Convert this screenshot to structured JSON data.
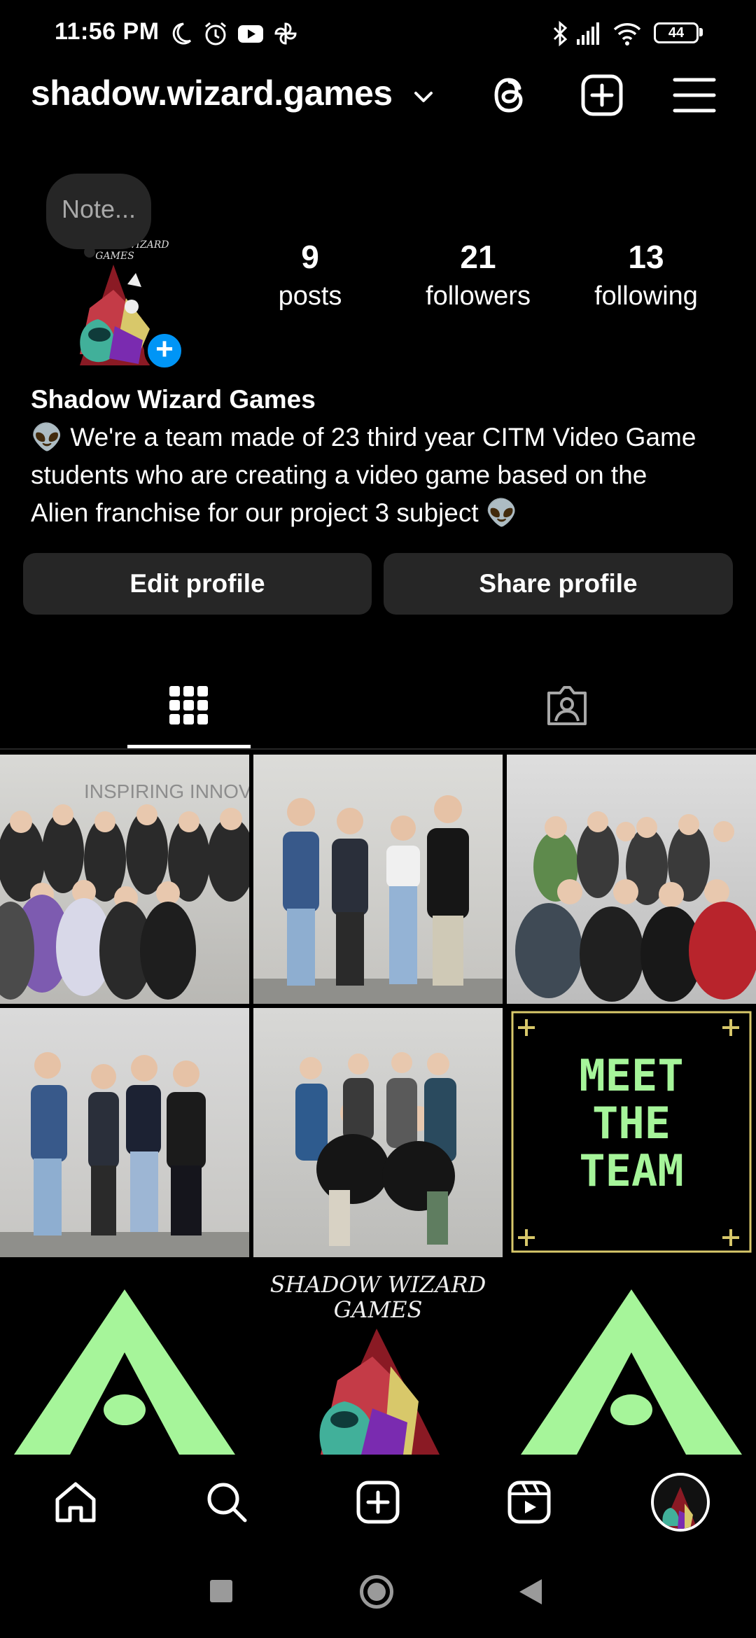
{
  "status_bar": {
    "time": "11:56 PM",
    "battery": "44",
    "icons": [
      "moon-icon",
      "alarm-icon",
      "youtube-icon",
      "pinwheel-icon",
      "bluetooth-icon",
      "signal-icon",
      "wifi-icon",
      "battery-icon"
    ]
  },
  "header": {
    "username": "shadow.wizard.games",
    "icons": [
      "chevron-down-icon",
      "threads-icon",
      "new-post-icon",
      "menu-icon"
    ]
  },
  "note": {
    "placeholder": "Note..."
  },
  "avatar": {
    "logo_text_line1": "SHADOW WIZARD",
    "logo_text_line2": "GAMES"
  },
  "stats": [
    {
      "value": "9",
      "label": "posts"
    },
    {
      "value": "21",
      "label": "followers"
    },
    {
      "value": "13",
      "label": "following"
    }
  ],
  "profile": {
    "name": "Shadow Wizard Games",
    "bio_line1": "👽 We're a team made of 23 third year CITM Video Game",
    "bio_line2": "students who are creating a video game based on the",
    "bio_line3": "Alien franchise for our project 3 subject 👽"
  },
  "buttons": {
    "edit": "Edit profile",
    "share": "Share profile"
  },
  "tabs": {
    "icons": [
      "grid-icon",
      "tagged-icon"
    ],
    "active": "grid"
  },
  "grid": {
    "tiles": [
      {
        "kind": "photo",
        "description_icon": "group-photo"
      },
      {
        "kind": "photo",
        "description_icon": "group-photo"
      },
      {
        "kind": "photo",
        "description_icon": "group-photo"
      },
      {
        "kind": "photo",
        "description_icon": "group-photo"
      },
      {
        "kind": "photo",
        "description_icon": "group-photo"
      },
      {
        "kind": "graphic",
        "line1": "MEET",
        "line2": "THE",
        "line3": "TEAM"
      },
      {
        "kind": "logo",
        "logo_line1": "SHADOW WIZARD",
        "logo_line2": "GAMES"
      },
      {
        "kind": "logo-triangle"
      },
      {
        "kind": "logo-triangle"
      }
    ],
    "photo_backdrop_text": "INSPIRING INNOVAT"
  },
  "bottom_nav": {
    "icons": [
      "home-icon",
      "search-icon",
      "create-icon",
      "reels-icon",
      "profile-avatar-icon"
    ]
  },
  "system_nav": {
    "icons": [
      "recents-icon",
      "home-circle-icon",
      "back-icon"
    ]
  },
  "colors": {
    "accent": "#0095f6",
    "button_bg": "#262626",
    "meet_green": "#a6f59a",
    "gold": "#d8c86a"
  }
}
